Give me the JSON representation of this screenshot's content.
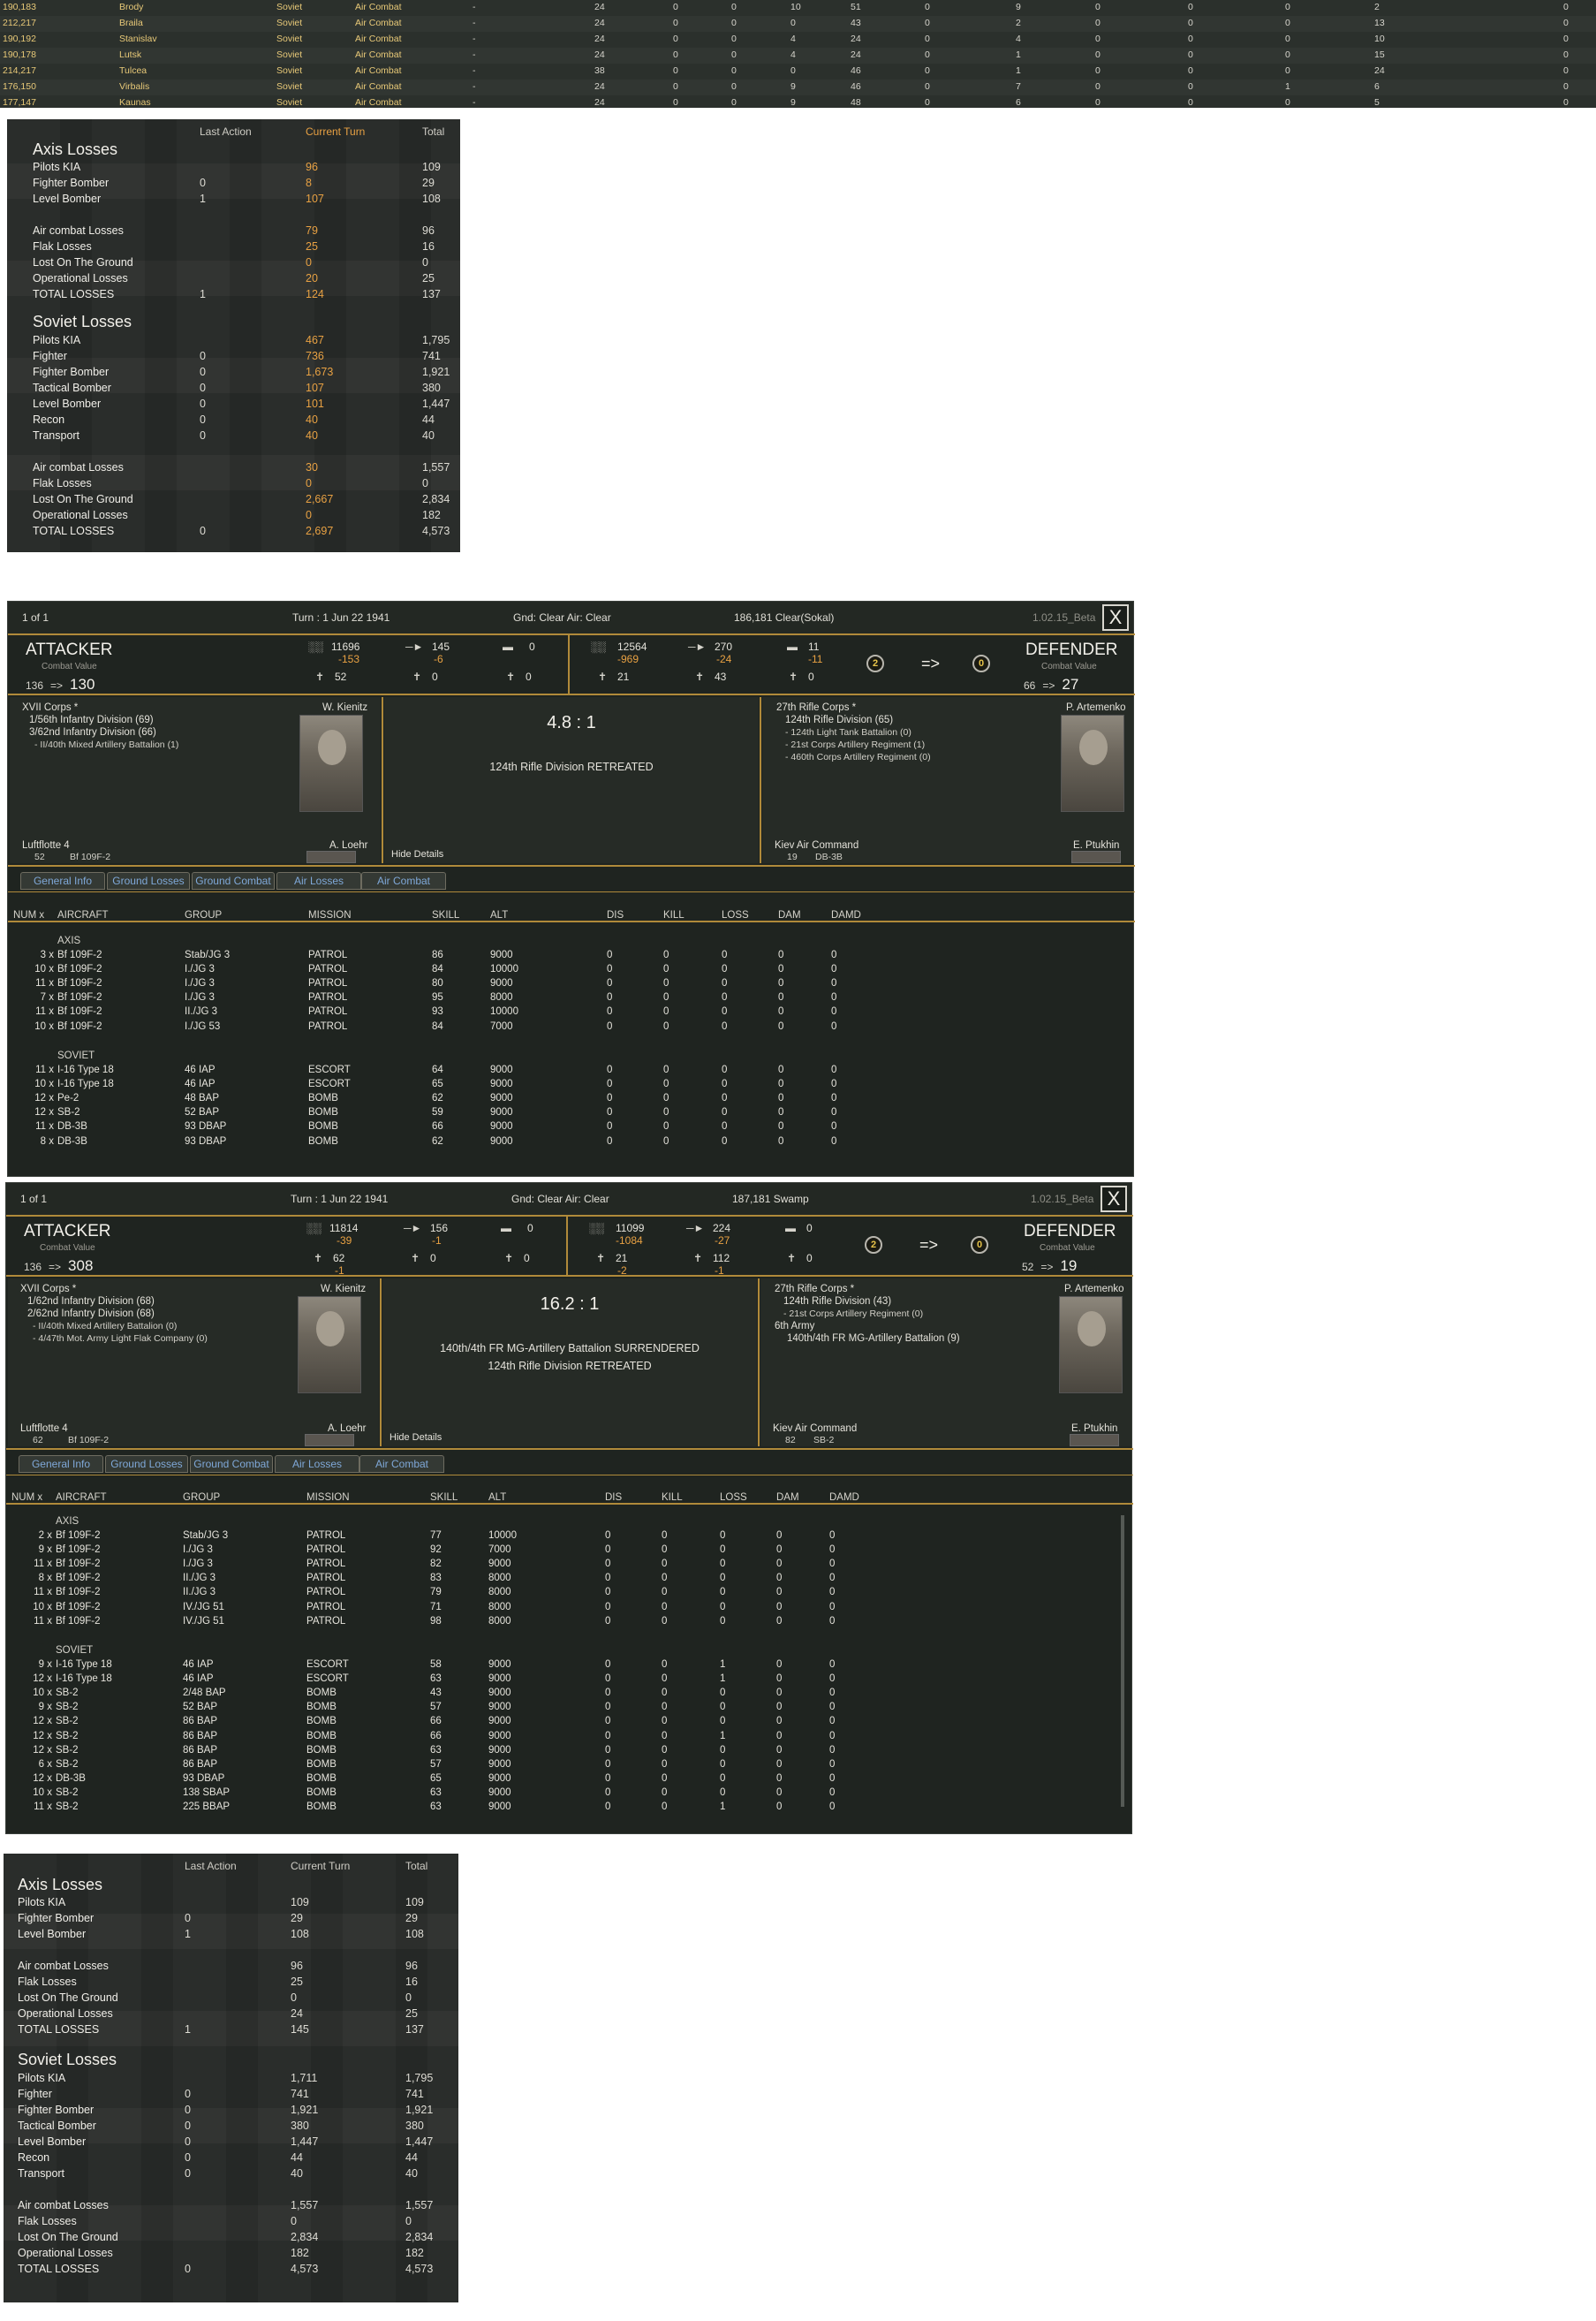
{
  "top_log": [
    {
      "coord": "190,183",
      "city": "Brody",
      "side": "Soviet",
      "type": "Air Combat",
      "dash": "-",
      "n": [
        "24",
        "0",
        "0",
        "10",
        "51",
        "0",
        "9",
        "0",
        "0",
        "0",
        "2",
        "0"
      ]
    },
    {
      "coord": "212,217",
      "city": "Braila",
      "side": "Soviet",
      "type": "Air Combat",
      "dash": "-",
      "n": [
        "24",
        "0",
        "0",
        "0",
        "43",
        "0",
        "2",
        "0",
        "0",
        "0",
        "13",
        "0"
      ]
    },
    {
      "coord": "190,192",
      "city": "Stanislav",
      "side": "Soviet",
      "type": "Air Combat",
      "dash": "-",
      "n": [
        "24",
        "0",
        "0",
        "4",
        "24",
        "0",
        "4",
        "0",
        "0",
        "0",
        "10",
        "0"
      ]
    },
    {
      "coord": "190,178",
      "city": "Lutsk",
      "side": "Soviet",
      "type": "Air Combat",
      "dash": "-",
      "n": [
        "24",
        "0",
        "0",
        "4",
        "24",
        "0",
        "1",
        "0",
        "0",
        "0",
        "15",
        "0"
      ]
    },
    {
      "coord": "214,217",
      "city": "Tulcea",
      "side": "Soviet",
      "type": "Air Combat",
      "dash": "-",
      "n": [
        "38",
        "0",
        "0",
        "0",
        "46",
        "0",
        "1",
        "0",
        "0",
        "0",
        "24",
        "0"
      ]
    },
    {
      "coord": "176,150",
      "city": "Virbalis",
      "side": "Soviet",
      "type": "Air Combat",
      "dash": "-",
      "n": [
        "24",
        "0",
        "0",
        "9",
        "46",
        "0",
        "7",
        "0",
        "0",
        "1",
        "6",
        "0"
      ]
    },
    {
      "coord": "177,147",
      "city": "Kaunas",
      "side": "Soviet",
      "type": "Air Combat",
      "dash": "-",
      "n": [
        "24",
        "0",
        "0",
        "9",
        "48",
        "0",
        "6",
        "0",
        "0",
        "0",
        "5",
        "0"
      ]
    }
  ],
  "summary1": {
    "headers": {
      "last": "Last Action",
      "current": "Current Turn",
      "total": "Total"
    },
    "axis_title": "Axis Losses",
    "soviet_title": "Soviet Losses",
    "axis_rows": [
      {
        "label": "Pilots KIA",
        "last": "",
        "cur": "96",
        "total": "109"
      },
      {
        "label": "Fighter Bomber",
        "last": "0",
        "cur": "8",
        "total": "29"
      },
      {
        "label": "Level Bomber",
        "last": "1",
        "cur": "107",
        "total": "108"
      },
      {
        "label": "Air combat Losses",
        "last": "",
        "cur": "79",
        "total": "96"
      },
      {
        "label": "Flak Losses",
        "last": "",
        "cur": "25",
        "total": "16"
      },
      {
        "label": "Lost On The Ground",
        "last": "",
        "cur": "0",
        "total": "0"
      },
      {
        "label": "Operational Losses",
        "last": "",
        "cur": "20",
        "total": "25"
      },
      {
        "label": "TOTAL LOSSES",
        "last": "1",
        "cur": "124",
        "total": "137"
      }
    ],
    "soviet_rows": [
      {
        "label": "Pilots KIA",
        "last": "",
        "cur": "467",
        "total": "1,795"
      },
      {
        "label": "Fighter",
        "last": "0",
        "cur": "736",
        "total": "741"
      },
      {
        "label": "Fighter Bomber",
        "last": "0",
        "cur": "1,673",
        "total": "1,921"
      },
      {
        "label": "Tactical Bomber",
        "last": "0",
        "cur": "107",
        "total": "380"
      },
      {
        "label": "Level Bomber",
        "last": "0",
        "cur": "101",
        "total": "1,447"
      },
      {
        "label": "Recon",
        "last": "0",
        "cur": "40",
        "total": "44"
      },
      {
        "label": "Transport",
        "last": "0",
        "cur": "40",
        "total": "40"
      },
      {
        "label": "Air combat Losses",
        "last": "",
        "cur": "30",
        "total": "1,557"
      },
      {
        "label": "Flak Losses",
        "last": "",
        "cur": "0",
        "total": "0"
      },
      {
        "label": "Lost On The Ground",
        "last": "",
        "cur": "2,667",
        "total": "2,834"
      },
      {
        "label": "Operational Losses",
        "last": "",
        "cur": "0",
        "total": "182"
      },
      {
        "label": "TOTAL LOSSES",
        "last": "0",
        "cur": "2,697",
        "total": "4,573"
      }
    ]
  },
  "summary2": {
    "headers": {
      "last": "Last Action",
      "current": "Current Turn",
      "total": "Total"
    },
    "axis_title": "Axis Losses",
    "soviet_title": "Soviet Losses",
    "axis_rows": [
      {
        "label": "Pilots KIA",
        "last": "",
        "cur": "109",
        "total": "109"
      },
      {
        "label": "Fighter Bomber",
        "last": "0",
        "cur": "29",
        "total": "29"
      },
      {
        "label": "Level Bomber",
        "last": "1",
        "cur": "108",
        "total": "108"
      },
      {
        "label": "Air combat Losses",
        "last": "",
        "cur": "96",
        "total": "96"
      },
      {
        "label": "Flak Losses",
        "last": "",
        "cur": "25",
        "total": "16"
      },
      {
        "label": "Lost On The Ground",
        "last": "",
        "cur": "0",
        "total": "0"
      },
      {
        "label": "Operational Losses",
        "last": "",
        "cur": "24",
        "total": "25"
      },
      {
        "label": "TOTAL LOSSES",
        "last": "1",
        "cur": "145",
        "total": "137"
      }
    ],
    "soviet_rows": [
      {
        "label": "Pilots KIA",
        "last": "",
        "cur": "1,711",
        "total": "1,795"
      },
      {
        "label": "Fighter",
        "last": "0",
        "cur": "741",
        "total": "741"
      },
      {
        "label": "Fighter Bomber",
        "last": "0",
        "cur": "1,921",
        "total": "1,921"
      },
      {
        "label": "Tactical Bomber",
        "last": "0",
        "cur": "380",
        "total": "380"
      },
      {
        "label": "Level Bomber",
        "last": "0",
        "cur": "1,447",
        "total": "1,447"
      },
      {
        "label": "Recon",
        "last": "0",
        "cur": "44",
        "total": "44"
      },
      {
        "label": "Transport",
        "last": "0",
        "cur": "40",
        "total": "40"
      },
      {
        "label": "Air combat Losses",
        "last": "",
        "cur": "1,557",
        "total": "1,557"
      },
      {
        "label": "Flak Losses",
        "last": "",
        "cur": "0",
        "total": "0"
      },
      {
        "label": "Lost On The Ground",
        "last": "",
        "cur": "2,834",
        "total": "2,834"
      },
      {
        "label": "Operational Losses",
        "last": "",
        "cur": "182",
        "total": "182"
      },
      {
        "label": "TOTAL LOSSES",
        "last": "0",
        "cur": "4,573",
        "total": "4,573"
      }
    ]
  },
  "combat1": {
    "page": "1 of 1",
    "turn": "Turn : 1   Jun 22 1941",
    "weather": "Gnd: Clear  Air: Clear",
    "location": "186,181   Clear(Sokal)",
    "version": "1.02.15_Beta",
    "close": "X",
    "attacker_label": "ATTACKER",
    "defender_label": "DEFENDER",
    "cv_label": "Combat Value",
    "att_cv_from": "136",
    "att_cv_to": "130",
    "def_cv_from": "66",
    "def_cv_to": "27",
    "cv_arrow": "=>",
    "att": {
      "men": "11696",
      "men_loss": "-153",
      "guns": "145",
      "guns_loss": "-6",
      "afv": "0",
      "air": "52",
      "air2": "0",
      "air3": "0"
    },
    "def": {
      "men": "12564",
      "men_loss": "-969",
      "guns": "270",
      "guns_loss": "-24",
      "afv": "11",
      "afv_loss": "-11",
      "air": "21",
      "air2": "43",
      "air3": "0"
    },
    "fort_from": "2",
    "fort_to": "0",
    "fort_arrow": "=>",
    "att_units": [
      "XVII Corps *",
      "1/56th Infantry Division (69)",
      "3/62nd Infantry Division (66)",
      "- II/40th Mixed Artillery Battalion (1)"
    ],
    "att_leader": "W. Kienitz",
    "att_air_hq": "Luftflotte 4",
    "att_air_leader": "A. Loehr",
    "att_air_count": "52",
    "att_air_type": "Bf 109F-2",
    "def_units": [
      "27th Rifle Corps *",
      "124th Rifle Division (65)",
      "- 124th Light Tank Battalion (0)",
      "- 21st Corps Artillery Regiment (1)",
      "- 460th Corps Artillery Regiment (0)"
    ],
    "def_leader": "P. Artemenko",
    "def_air_hq": "Kiev Air Command",
    "def_air_leader": "E. Ptukhin",
    "def_air_count": "19",
    "def_air_type": "DB-3B",
    "odds": "4.8 : 1",
    "results": [
      "124th Rifle Division RETREATED"
    ],
    "hide": "Hide Details",
    "tabs": [
      "General Info",
      "Ground Losses",
      "Ground Combat",
      "Air Losses",
      "Air Combat"
    ],
    "cols": [
      "NUM x",
      "AIRCRAFT",
      "GROUP",
      "MISSION",
      "SKILL",
      "ALT",
      "DIS",
      "KILL",
      "LOSS",
      "DAM",
      "DAMD"
    ],
    "axis_label": "AXIS",
    "soviet_label": "SOVIET",
    "axis": [
      [
        "3 x",
        "Bf 109F-2",
        "Stab/JG 3",
        "PATROL",
        "86",
        "9000",
        "0",
        "0",
        "0",
        "0",
        "0"
      ],
      [
        "10 x",
        "Bf 109F-2",
        "I./JG 3",
        "PATROL",
        "84",
        "10000",
        "0",
        "0",
        "0",
        "0",
        "0"
      ],
      [
        "11 x",
        "Bf 109F-2",
        "I./JG 3",
        "PATROL",
        "80",
        "9000",
        "0",
        "0",
        "0",
        "0",
        "0"
      ],
      [
        "7 x",
        "Bf 109F-2",
        "I./JG 3",
        "PATROL",
        "95",
        "8000",
        "0",
        "0",
        "0",
        "0",
        "0"
      ],
      [
        "11 x",
        "Bf 109F-2",
        "II./JG 3",
        "PATROL",
        "93",
        "10000",
        "0",
        "0",
        "0",
        "0",
        "0"
      ],
      [
        "10 x",
        "Bf 109F-2",
        "I./JG 53",
        "PATROL",
        "84",
        "7000",
        "0",
        "0",
        "0",
        "0",
        "0"
      ]
    ],
    "soviet": [
      [
        "11 x",
        "I-16 Type 18",
        "46 IAP",
        "ESCORT",
        "64",
        "9000",
        "0",
        "0",
        "0",
        "0",
        "0"
      ],
      [
        "10 x",
        "I-16 Type 18",
        "46 IAP",
        "ESCORT",
        "65",
        "9000",
        "0",
        "0",
        "0",
        "0",
        "0"
      ],
      [
        "12 x",
        "Pe-2",
        "48 BAP",
        "BOMB",
        "62",
        "9000",
        "0",
        "0",
        "0",
        "0",
        "0"
      ],
      [
        "12 x",
        "SB-2",
        "52 BAP",
        "BOMB",
        "59",
        "9000",
        "0",
        "0",
        "0",
        "0",
        "0"
      ],
      [
        "11 x",
        "DB-3B",
        "93 DBAP",
        "BOMB",
        "66",
        "9000",
        "0",
        "0",
        "0",
        "0",
        "0"
      ],
      [
        "8 x",
        "DB-3B",
        "93 DBAP",
        "BOMB",
        "62",
        "9000",
        "0",
        "0",
        "0",
        "0",
        "0"
      ]
    ]
  },
  "combat2": {
    "page": "1 of 1",
    "turn": "Turn : 1   Jun 22 1941",
    "weather": "Gnd: Clear  Air: Clear",
    "location": "187,181   Swamp",
    "version": "1.02.15_Beta",
    "close": "X",
    "attacker_label": "ATTACKER",
    "defender_label": "DEFENDER",
    "cv_label": "Combat Value",
    "att_cv_from": "136",
    "att_cv_to": "308",
    "def_cv_from": "52",
    "def_cv_to": "19",
    "cv_arrow": "=>",
    "att": {
      "men": "11814",
      "men_loss": "-39",
      "guns": "156",
      "guns_loss": "-1",
      "afv": "0",
      "air": "62",
      "air_loss": "-1",
      "air2": "0",
      "air3": "0"
    },
    "def": {
      "men": "11099",
      "men_loss": "-1084",
      "guns": "224",
      "guns_loss": "-27",
      "afv": "0",
      "air": "21",
      "air_loss": "-2",
      "air2": "112",
      "air2_loss": "-1",
      "air3": "0"
    },
    "fort_from": "2",
    "fort_to": "0",
    "fort_arrow": "=>",
    "att_units": [
      "XVII Corps *",
      "1/62nd Infantry Division (68)",
      "2/62nd Infantry Division (68)",
      "- II/40th Mixed Artillery Battalion (0)",
      "- 4/47th Mot. Army Light Flak Company (0)"
    ],
    "att_leader": "W. Kienitz",
    "att_air_hq": "Luftflotte 4",
    "att_air_leader": "A. Loehr",
    "att_air_count": "62",
    "att_air_type": "Bf 109F-2",
    "def_units": [
      "27th Rifle Corps *",
      "124th Rifle Division (43)",
      "- 21st Corps Artillery Regiment (0)",
      "6th Army",
      "140th/4th FR MG-Artillery Battalion (9)"
    ],
    "def_leader": "P. Artemenko",
    "def_air_hq": "Kiev Air Command",
    "def_air_leader": "E. Ptukhin",
    "def_air_count": "82",
    "def_air_type": "SB-2",
    "odds": "16.2 : 1",
    "results": [
      "140th/4th FR MG-Artillery Battalion SURRENDERED",
      "124th Rifle Division RETREATED"
    ],
    "hide": "Hide Details",
    "tabs": [
      "General Info",
      "Ground Losses",
      "Ground Combat",
      "Air Losses",
      "Air Combat"
    ],
    "cols": [
      "NUM x",
      "AIRCRAFT",
      "GROUP",
      "MISSION",
      "SKILL",
      "ALT",
      "DIS",
      "KILL",
      "LOSS",
      "DAM",
      "DAMD"
    ],
    "axis_label": "AXIS",
    "soviet_label": "SOVIET",
    "axis": [
      [
        "2 x",
        "Bf 109F-2",
        "Stab/JG 3",
        "PATROL",
        "77",
        "10000",
        "0",
        "0",
        "0",
        "0",
        "0"
      ],
      [
        "9 x",
        "Bf 109F-2",
        "I./JG 3",
        "PATROL",
        "92",
        "7000",
        "0",
        "0",
        "0",
        "0",
        "0"
      ],
      [
        "11 x",
        "Bf 109F-2",
        "I./JG 3",
        "PATROL",
        "82",
        "9000",
        "0",
        "0",
        "0",
        "0",
        "0"
      ],
      [
        "8 x",
        "Bf 109F-2",
        "II./JG 3",
        "PATROL",
        "83",
        "8000",
        "0",
        "0",
        "0",
        "0",
        "0"
      ],
      [
        "11 x",
        "Bf 109F-2",
        "II./JG 3",
        "PATROL",
        "79",
        "8000",
        "0",
        "0",
        "0",
        "0",
        "0"
      ],
      [
        "10 x",
        "Bf 109F-2",
        "IV./JG 51",
        "PATROL",
        "71",
        "8000",
        "0",
        "0",
        "0",
        "0",
        "0"
      ],
      [
        "11 x",
        "Bf 109F-2",
        "IV./JG 51",
        "PATROL",
        "98",
        "8000",
        "0",
        "0",
        "0",
        "0",
        "0"
      ]
    ],
    "soviet": [
      [
        "9 x",
        "I-16 Type 18",
        "46 IAP",
        "ESCORT",
        "58",
        "9000",
        "0",
        "0",
        "1",
        "0",
        "0"
      ],
      [
        "12 x",
        "I-16 Type 18",
        "46 IAP",
        "ESCORT",
        "63",
        "9000",
        "0",
        "0",
        "1",
        "0",
        "0"
      ],
      [
        "10 x",
        "SB-2",
        "2/48 BAP",
        "BOMB",
        "43",
        "9000",
        "0",
        "0",
        "0",
        "0",
        "0"
      ],
      [
        "9 x",
        "SB-2",
        "52 BAP",
        "BOMB",
        "57",
        "9000",
        "0",
        "0",
        "0",
        "0",
        "0"
      ],
      [
        "12 x",
        "SB-2",
        "86 BAP",
        "BOMB",
        "66",
        "9000",
        "0",
        "0",
        "0",
        "0",
        "0"
      ],
      [
        "12 x",
        "SB-2",
        "86 BAP",
        "BOMB",
        "66",
        "9000",
        "0",
        "0",
        "1",
        "0",
        "0"
      ],
      [
        "12 x",
        "SB-2",
        "86 BAP",
        "BOMB",
        "63",
        "9000",
        "0",
        "0",
        "0",
        "0",
        "0"
      ],
      [
        "6 x",
        "SB-2",
        "86 BAP",
        "BOMB",
        "57",
        "9000",
        "0",
        "0",
        "0",
        "0",
        "0"
      ],
      [
        "12 x",
        "DB-3B",
        "93 DBAP",
        "BOMB",
        "65",
        "9000",
        "0",
        "0",
        "0",
        "0",
        "0"
      ],
      [
        "10 x",
        "SB-2",
        "138 SBAP",
        "BOMB",
        "63",
        "9000",
        "0",
        "0",
        "0",
        "0",
        "0"
      ],
      [
        "11 x",
        "SB-2",
        "225 BBAP",
        "BOMB",
        "63",
        "9000",
        "0",
        "0",
        "1",
        "0",
        "0"
      ]
    ]
  },
  "colors": {
    "gold": "#b08a3a",
    "orange": "#e8a143",
    "panel": "#1f2420"
  }
}
